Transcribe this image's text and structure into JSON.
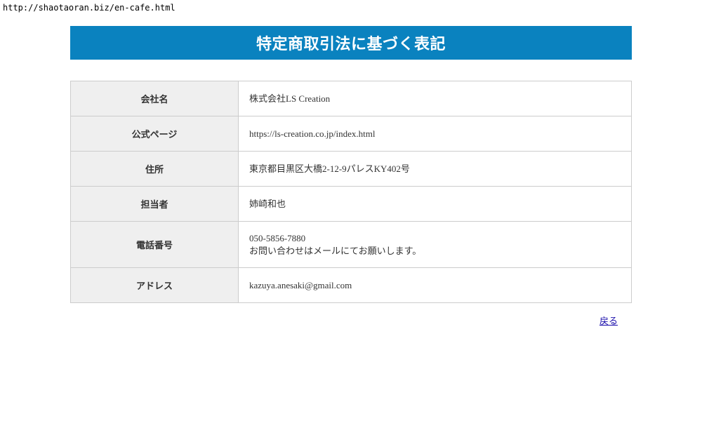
{
  "browser": {
    "url": "http://shaotaoran.biz/en-cafe.html"
  },
  "page": {
    "title": "特定商取引法に基づく表記"
  },
  "table": {
    "rows": [
      {
        "label": "会社名",
        "value": "株式会社LS Creation"
      },
      {
        "label": "公式ページ",
        "value": "https://ls-creation.co.jp/index.html"
      },
      {
        "label": "住所",
        "value": "東京都目黒区大橋2-12-9パレスKY402号"
      },
      {
        "label": "担当者",
        "value": "姉崎和也"
      },
      {
        "label": "電話番号",
        "value": "050-5856-7880",
        "value_line2": "お問い合わせはメールにてお願いします。"
      },
      {
        "label": "アドレス",
        "value": "kazuya.anesaki@gmail.com"
      }
    ]
  },
  "footer": {
    "back_label": "戻る"
  },
  "colors": {
    "banner": "#0a82bf",
    "label_bg": "#efefef",
    "border": "#cccccc",
    "link": "#1a0dab"
  }
}
